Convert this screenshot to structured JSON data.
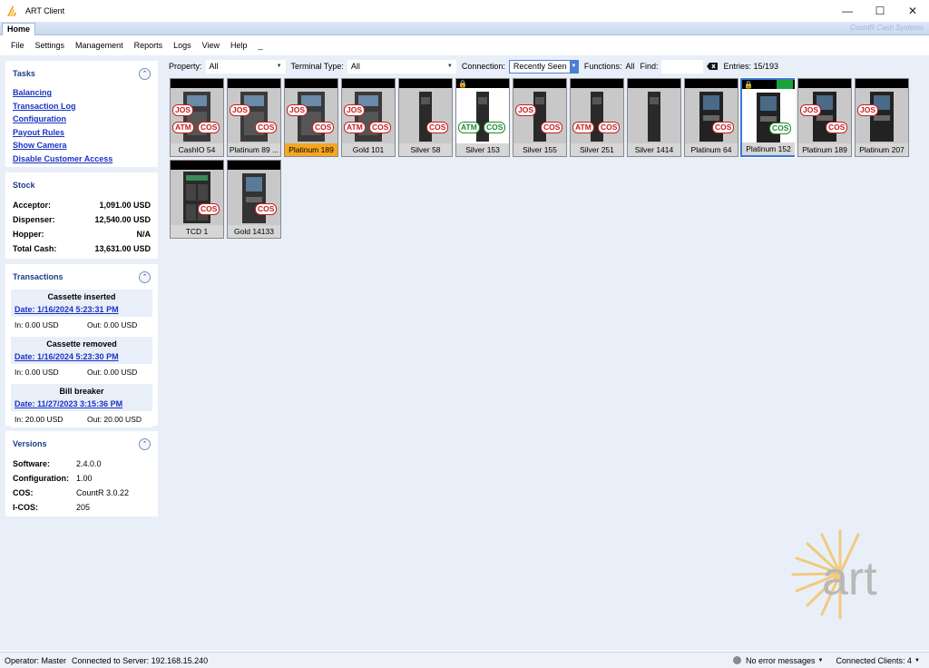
{
  "window": {
    "title": "ART Client",
    "minimize": "—",
    "maximize": "☐",
    "close": "✕"
  },
  "ribbon": {
    "tab": "Home",
    "brand": "CountR Cash Systems"
  },
  "menu": [
    "File",
    "Settings",
    "Management",
    "Reports",
    "Logs",
    "View",
    "Help",
    "_"
  ],
  "tasks": {
    "title": "Tasks",
    "items": [
      "Balancing",
      "Transaction Log",
      "Configuration",
      "Payout Rules",
      "Show Camera",
      "Disable Customer Access"
    ]
  },
  "stock": {
    "title": "Stock",
    "rows": [
      {
        "label": "Acceptor:",
        "value": "1,091.00 USD"
      },
      {
        "label": "Dispenser:",
        "value": "12,540.00 USD"
      },
      {
        "label": "Hopper:",
        "value": "N/A"
      },
      {
        "label": "Total Cash:",
        "value": "13,631.00 USD"
      }
    ]
  },
  "transactions": {
    "title": "Transactions",
    "items": [
      {
        "title": "Cassette inserted",
        "date": "Date: 1/16/2024 5:23:31 PM",
        "in": "In: 0.00 USD",
        "out": "Out: 0.00 USD"
      },
      {
        "title": "Cassette removed",
        "date": "Date: 1/16/2024 5:23:30 PM",
        "in": "In: 0.00 USD",
        "out": "Out: 0.00 USD"
      },
      {
        "title": "Bill breaker",
        "date": "Date: 11/27/2023 3:15:36 PM",
        "in": "In: 20.00 USD",
        "out": "Out: 20.00 USD"
      }
    ]
  },
  "versions": {
    "title": "Versions",
    "rows": [
      {
        "label": "Software:",
        "value": "2.4.0.0"
      },
      {
        "label": "Configuration:",
        "value": "1.00"
      },
      {
        "label": "COS:",
        "value": "CountR 3.0.22"
      },
      {
        "label": "I-COS:",
        "value": "205"
      }
    ]
  },
  "filters": {
    "property_label": "Property:",
    "property_value": "All",
    "terminal_label": "Terminal Type:",
    "terminal_value": "All",
    "connection_label": "Connection:",
    "connection_value": "Recently Seen",
    "functions_label": "Functions:",
    "functions_value": "All",
    "find_label": "Find:",
    "entries": "Entries: 15/193"
  },
  "terminals": [
    {
      "name": "CashIO 54",
      "badges": [
        "JOS",
        "ATM",
        "COS"
      ]
    },
    {
      "name": "Platinum 89 ...",
      "badges": [
        "JOS",
        "COS"
      ]
    },
    {
      "name": "Platinum 189",
      "badges": [
        "JOS",
        "COS"
      ]
    },
    {
      "name": "Gold 101",
      "badges": [
        "JOS",
        "ATM",
        "COS"
      ]
    },
    {
      "name": "Silver 58",
      "badges": [
        "COS"
      ]
    },
    {
      "name": "Silver 153",
      "badges": [
        "ATM",
        "COS"
      ]
    },
    {
      "name": "Silver 155",
      "badges": [
        "JOS",
        "COS"
      ]
    },
    {
      "name": "Silver 251",
      "badges": [
        "ATM",
        "COS"
      ]
    },
    {
      "name": "Silver 1414",
      "badges": []
    },
    {
      "name": "Platinum 64",
      "badges": [
        "COS"
      ]
    },
    {
      "name": "Platinum 152",
      "badges": [
        "COS"
      ]
    },
    {
      "name": "Platinum 189",
      "badges": [
        "JOS",
        "COS"
      ]
    },
    {
      "name": "Platinum 207",
      "badges": [
        "JOS"
      ]
    },
    {
      "name": "TCD 1",
      "badges": [
        "COS"
      ]
    },
    {
      "name": "Gold 14133",
      "badges": [
        "COS"
      ]
    }
  ],
  "logo": {
    "text": "art"
  },
  "status": {
    "operator": "Operator: Master",
    "server": "Connected to Server: 192.168.15.240",
    "errors": "No error messages",
    "clients": "Connected Clients: 4"
  }
}
